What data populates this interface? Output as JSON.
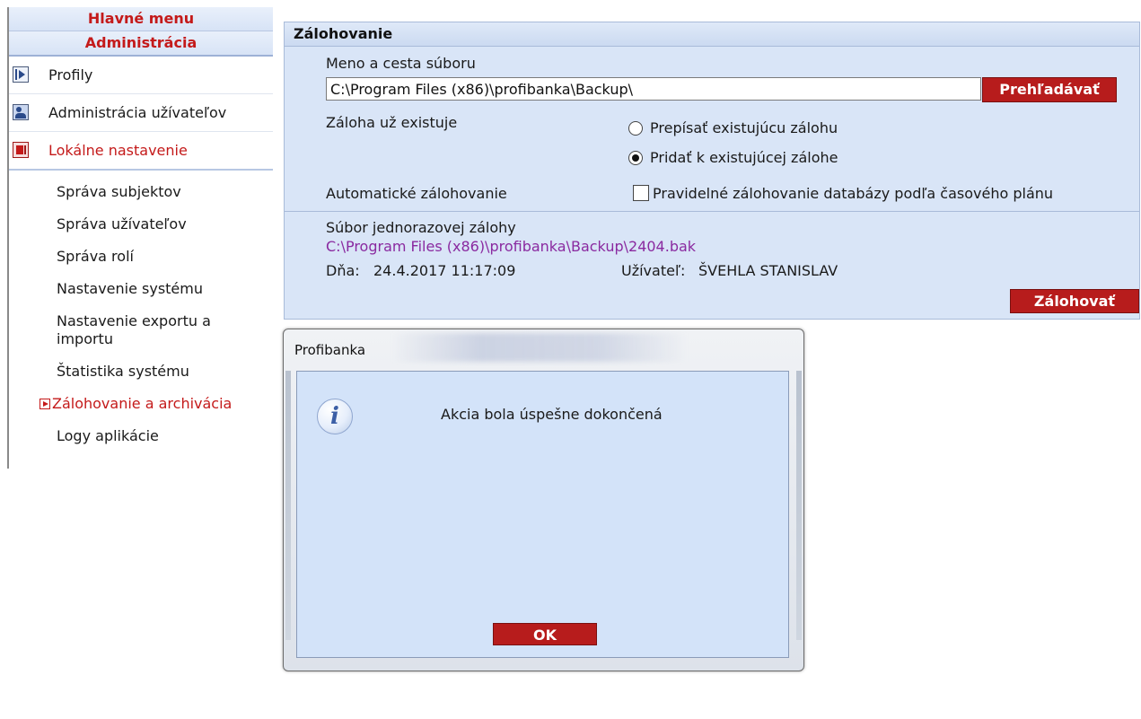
{
  "sidebar": {
    "header_main": "Hlavné menu",
    "header_admin": "Administrácia",
    "main_items": [
      {
        "label": "Profily",
        "icon": "profile-icon"
      },
      {
        "label": "Administrácia užívateľov",
        "icon": "users-icon"
      },
      {
        "label": "Lokálne nastavenie",
        "icon": "local-settings-icon"
      }
    ],
    "sub_items": [
      "Správa subjektov",
      "Správa užívateľov",
      "Správa rolí",
      "Nastavenie systému",
      "Nastavenie exportu a importu",
      "Štatistika systému",
      "Zálohovanie a archivácia",
      "Logy aplikácie"
    ]
  },
  "backup": {
    "title": "Zálohovanie",
    "file_label": "Meno a cesta súboru",
    "file_path": "C:\\Program Files (x86)\\profibanka\\Backup\\",
    "browse_button": "Prehľadávať",
    "exists_label": "Záloha už existuje",
    "option_overwrite": "Prepísať existujúcu zálohu",
    "option_append": "Pridať k existujúcej zálohe",
    "selected_option": "append",
    "auto_label": "Automatické zálohovanie",
    "auto_option": "Pravidelné zálohovanie databázy podľa časového plánu",
    "auto_checked": false,
    "single_label": "Súbor jednorazovej zálohy",
    "single_path": "C:\\Program Files (x86)\\profibanka\\Backup\\2404.bak",
    "date_label": "Dňa:",
    "date_value": "24.4.2017 11:17:09",
    "user_label": "Užívateľ:",
    "user_value": "ŠVEHLA STANISLAV",
    "backup_button": "Zálohovať"
  },
  "dialog": {
    "title": "Profibanka",
    "message": "Akcia bola úspešne dokončená",
    "ok_button": "OK"
  },
  "colors": {
    "accent_red": "#b71c1c",
    "panel_blue": "#d9e5f7",
    "link_purple": "#8a2aa0"
  }
}
